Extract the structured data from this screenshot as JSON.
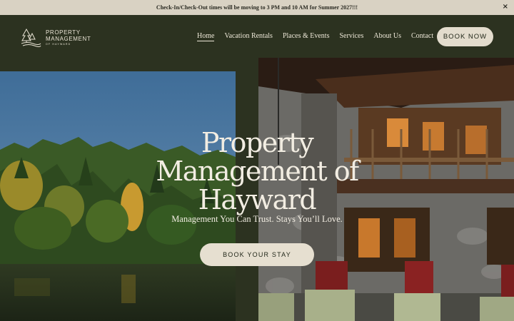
{
  "announcement": {
    "text": "Check-In/Check-Out times will be moving to 3 PM and 10 AM for Summer 2027!!!",
    "close_label": "×"
  },
  "logo": {
    "line1": "PROPERTY",
    "line2": "MANAGEMENT",
    "line3": "OF HAYWARD"
  },
  "nav": {
    "items": [
      {
        "label": "Home"
      },
      {
        "label": "Vacation Rentals"
      },
      {
        "label": "Places & Events"
      },
      {
        "label": "Services"
      },
      {
        "label": "About Us"
      },
      {
        "label": "Contact"
      }
    ],
    "book_label": "BOOK NOW"
  },
  "hero": {
    "title_line1": "Property",
    "title_line2": "Management of",
    "title_line3": "Hayward",
    "subtitle": "Management You Can Trust. Stays You’ll Love.",
    "button_label": "BOOK YOUR STAY"
  },
  "colors": {
    "header_bg": "#2c3220",
    "announcement_bg": "#d9d2c3",
    "button_bg": "#e3dccd"
  }
}
